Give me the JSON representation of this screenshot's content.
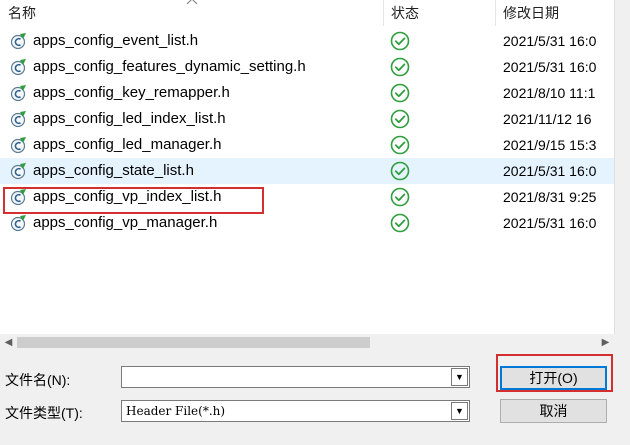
{
  "columns": {
    "name": "名称",
    "status": "状态",
    "date": "修改日期"
  },
  "files": [
    {
      "name": "apps_config_event_list.h",
      "date": "2021/5/31 16:0"
    },
    {
      "name": "apps_config_features_dynamic_setting.h",
      "date": "2021/5/31 16:0"
    },
    {
      "name": "apps_config_key_remapper.h",
      "date": "2021/8/10 11:1"
    },
    {
      "name": "apps_config_led_index_list.h",
      "date": "2021/11/12 16"
    },
    {
      "name": "apps_config_led_manager.h",
      "date": "2021/9/15 15:3"
    },
    {
      "name": "apps_config_state_list.h",
      "date": "2021/5/31 16:0"
    },
    {
      "name": "apps_config_vp_index_list.h",
      "date": "2021/8/31 9:25"
    },
    {
      "name": "apps_config_vp_manager.h",
      "date": "2021/5/31 16:0"
    }
  ],
  "form": {
    "filename_label": "文件名(N):",
    "filename_value": "",
    "filetype_label": "文件类型(T):",
    "filetype_value": "Header File(*.h)"
  },
  "buttons": {
    "open": "打开(O)",
    "cancel": "取消"
  },
  "colors": {
    "hover_row": "#e5f3ff",
    "highlight": "#d32f2f",
    "status_ok": "#2e9e3e",
    "default_button_border": "#0078d7"
  },
  "icons": {
    "file": "c-header-file-icon",
    "status": "check-circle-icon"
  }
}
